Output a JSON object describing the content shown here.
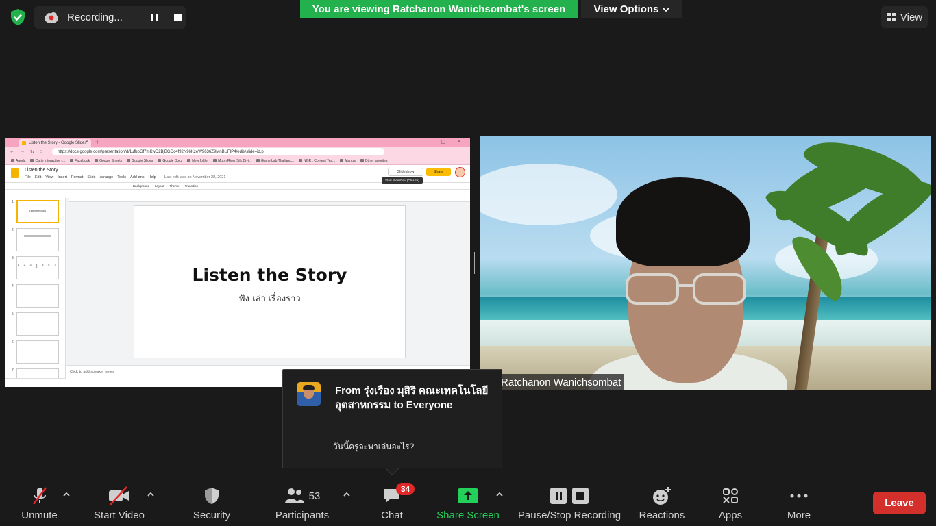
{
  "recording": {
    "label": "Recording..."
  },
  "banner": {
    "viewing_text": "You are viewing Ratchanon Wanichsombat's screen",
    "view_options": "View Options"
  },
  "view_button": {
    "label": "View"
  },
  "shared_screen": {
    "tab_title": "Listen the Story - Google Slides",
    "url": "https://docs.google.com/presentation/d/1ufbpGf7mKwD2BjBGOc4f92N96KzeW9636Z9MnBUFIP4/edit#slide=id.p",
    "bookmarks": [
      "Agoda",
      "Carte interactive -...",
      "Facebook",
      "Google Sheets",
      "Google Slides",
      "Google Docs",
      "New folder",
      "Moon River Silk Divi...",
      "Game Lab Thailand...",
      "NGR : Content Tea...",
      "Manga",
      "Other favorites"
    ],
    "doc_title": "Listen the Story",
    "menu": [
      "File",
      "Edit",
      "View",
      "Insert",
      "Format",
      "Slide",
      "Arrange",
      "Tools",
      "Add-ons",
      "Help"
    ],
    "last_edit": "Last edit was on November 28, 2021",
    "slideshow_label": "Slideshow",
    "tooltip": "Start slideshow (Ctrl+F5)",
    "share_label": "Share",
    "toolbar_items": [
      "Background",
      "Layout",
      "Theme",
      "Transition"
    ],
    "thumbnails": [
      {
        "num": "1",
        "text": "Listen the Story"
      },
      {
        "num": "2",
        "text": ""
      },
      {
        "num": "3",
        "text": "1 2 3 4 5 6 7 8"
      },
      {
        "num": "4",
        "text": ""
      },
      {
        "num": "5",
        "text": ""
      },
      {
        "num": "6",
        "text": ""
      },
      {
        "num": "7",
        "text": ""
      }
    ],
    "slide_title": "Listen the Story",
    "slide_subtitle": "ฟัง-เล่า เรื่องราว",
    "speaker_notes": "Click to add speaker notes"
  },
  "video": {
    "participant_name": "Ratchanon Wanichsombat"
  },
  "chat_popup": {
    "from": "From รุ่งเรือง มุสิริ คณะเทคโนโลยีอุตสาหกรรม to Everyone",
    "message": "วันนี้ครูจะพาเล่นอะไร?"
  },
  "toolbar": {
    "unmute": "Unmute",
    "start_video": "Start Video",
    "security": "Security",
    "participants": "Participants",
    "participants_count": "53",
    "chat": "Chat",
    "chat_badge": "34",
    "share_screen": "Share Screen",
    "pause_stop_recording": "Pause/Stop Recording",
    "reactions": "Reactions",
    "apps": "Apps",
    "more": "More",
    "leave": "Leave"
  },
  "colors": {
    "share_green": "#23b14d",
    "leave_red": "#d3302c",
    "badge_red": "#e02828"
  }
}
